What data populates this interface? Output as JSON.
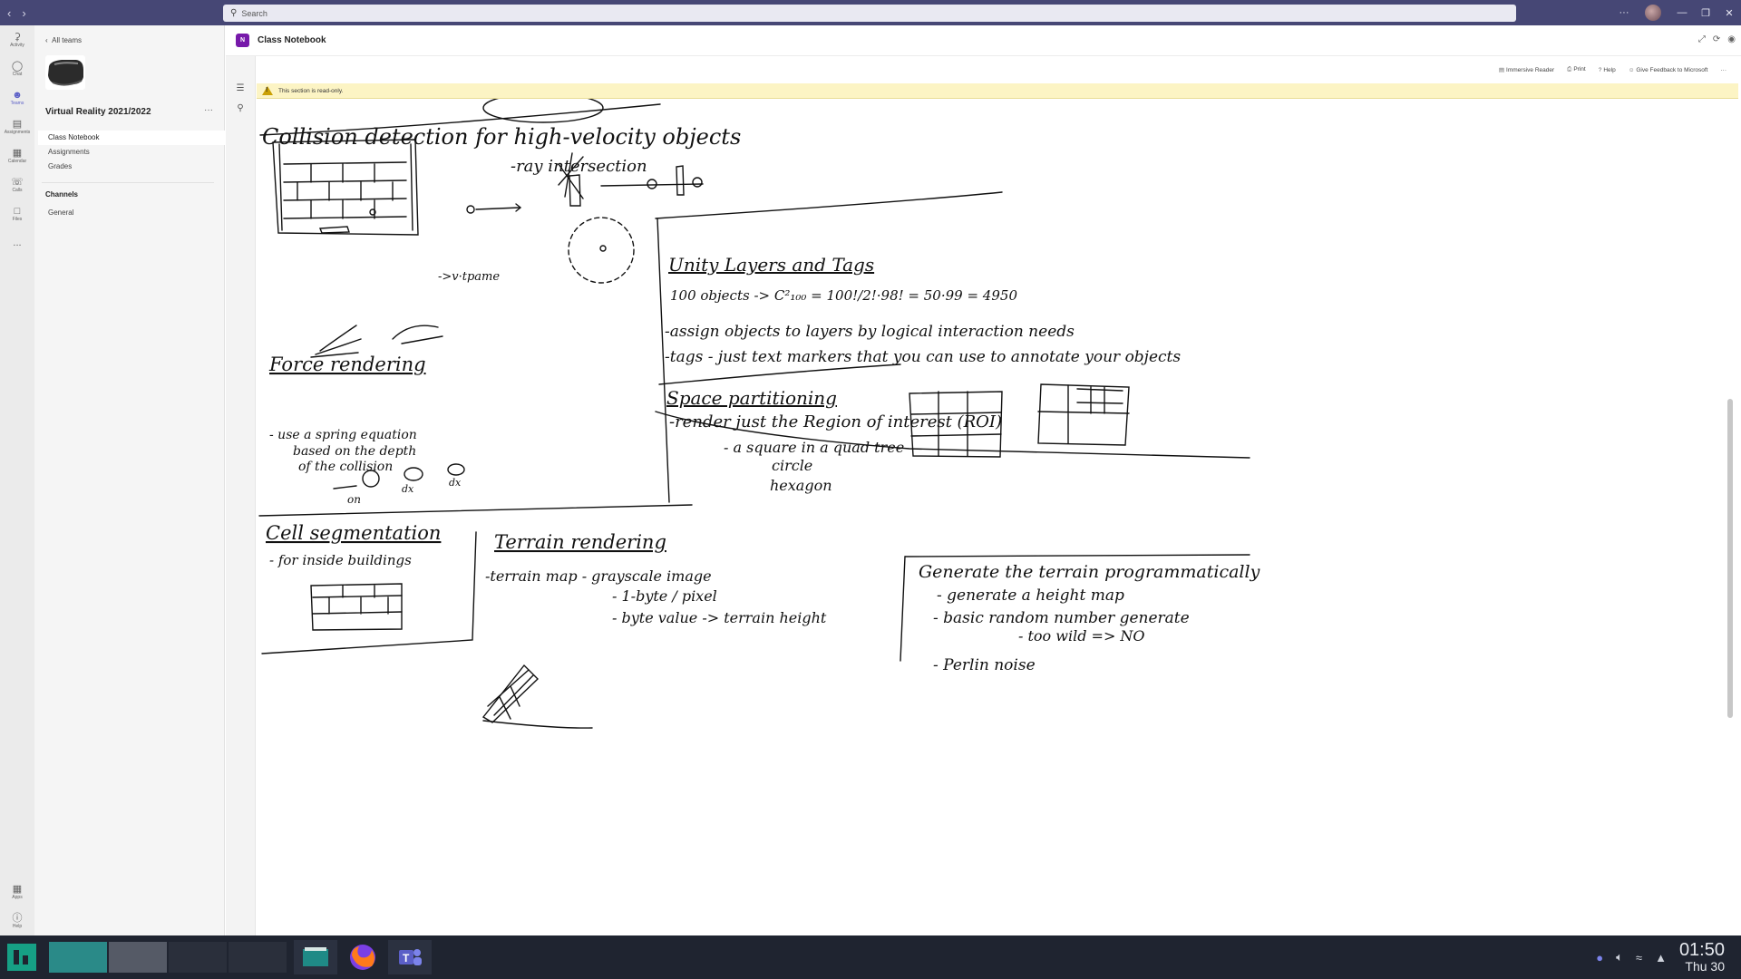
{
  "search": {
    "placeholder": "Search"
  },
  "rail": {
    "items": [
      {
        "label": "Activity",
        "icon": "bell-icon"
      },
      {
        "label": "Chat",
        "icon": "chat-icon"
      },
      {
        "label": "Teams",
        "icon": "teams-icon"
      },
      {
        "label": "Assignments",
        "icon": "assignments-icon"
      },
      {
        "label": "Calendar",
        "icon": "calendar-icon"
      },
      {
        "label": "Calls",
        "icon": "phone-icon"
      },
      {
        "label": "Files",
        "icon": "file-icon"
      }
    ],
    "more": "...",
    "apps": "Apps",
    "help": "Help"
  },
  "sidebar": {
    "back": "All teams",
    "team_name": "Virtual Reality 2021/2022",
    "more": "···",
    "items": [
      {
        "label": "Class Notebook"
      },
      {
        "label": "Assignments"
      },
      {
        "label": "Grades"
      }
    ],
    "channels_heading": "Channels",
    "channels": [
      {
        "label": "General"
      }
    ]
  },
  "main": {
    "app_icon": "N",
    "title": "Class Notebook"
  },
  "ribbon": {
    "immersive_reader": "Immersive Reader",
    "print": "Print",
    "help": "Help",
    "feedback": "Give Feedback to Microsoft",
    "more": "···"
  },
  "banner": {
    "text": "This section is read-only."
  },
  "notes": {
    "collision": "Collision detection for high-velocity objects",
    "ray": "-ray intersection",
    "vtime": "->v·tpame",
    "force": "Force rendering",
    "spring1": "- use a spring equation",
    "spring2": "based on the depth",
    "spring3": "of the collision",
    "on": "on",
    "dx1": "dx",
    "dx2": "dx",
    "unity_title": "Unity Layers and Tags",
    "unity1": "100 objects -> C²₁₀₀ = 100!/2!·98! = 50·99 = 4950",
    "unity2": "-assign objects to layers by logical interaction needs",
    "unity3": "-tags - just text markers that you can use to annotate your objects",
    "space_title": "Space partitioning",
    "space1": "-render just the Region of interest (ROI)",
    "space2": "- a square in a quad tree",
    "space3": "circle",
    "space4": "hexagon",
    "cell_title": "Cell segmentation",
    "cell1": "- for inside buildings",
    "terrain_title": "Terrain rendering",
    "terrain1": "-terrain map - grayscale image",
    "terrain2": "- 1-byte / pixel",
    "terrain3": "- byte value -> terrain height",
    "generate_title": "Generate the terrain programmatically",
    "gen1": "- generate a height map",
    "gen2": "- basic random number generate",
    "gen3": "- too wild => NO",
    "gen4": "- Perlin noise"
  },
  "taskbar": {
    "time": "01:50",
    "date": "Thu 30"
  },
  "colors": {
    "titlebar": "#464775",
    "accent": "#5b5fc7",
    "onenote": "#7719aa",
    "banner": "#fcf4c4"
  }
}
